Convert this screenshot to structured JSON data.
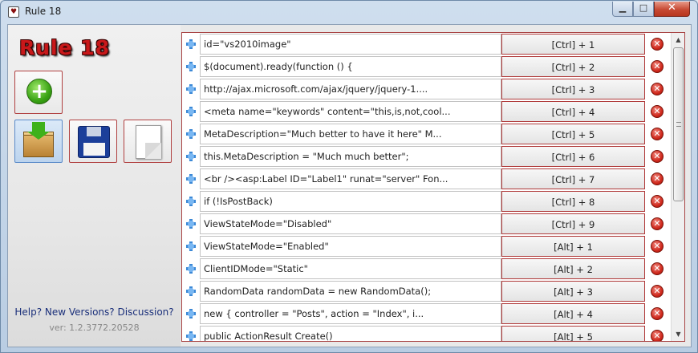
{
  "window": {
    "title": "Rule 18",
    "app_icon": "heart-icon"
  },
  "left_panel": {
    "logo_text": "Rule 18",
    "help_link": "Help? New Versions? Discussion?",
    "version": "ver: 1.2.3772.20528",
    "tools": [
      {
        "name": "add-rule-button",
        "icon": "plus-icon"
      },
      {
        "name": "load-button",
        "icon": "box-download-icon"
      },
      {
        "name": "save-button",
        "icon": "floppy-icon"
      },
      {
        "name": "new-button",
        "icon": "blank-page-icon"
      }
    ]
  },
  "rules": [
    {
      "text": "id=\"vs2010image\"",
      "hotkey": "[Ctrl] + 1"
    },
    {
      "text": "$(document).ready(function () {",
      "hotkey": "[Ctrl] + 2"
    },
    {
      "text": "http://ajax.microsoft.com/ajax/jquery/jquery-1....",
      "hotkey": "[Ctrl] + 3"
    },
    {
      "text": "<meta name=\"keywords\" content=\"this,is,not,cool...",
      "hotkey": "[Ctrl] + 4"
    },
    {
      "text": "MetaDescription=\"Much better to have it here\" M...",
      "hotkey": "[Ctrl] + 5"
    },
    {
      "text": "this.MetaDescription = \"Much much better\";",
      "hotkey": "[Ctrl] + 6"
    },
    {
      "text": "<br /><asp:Label ID=\"Label1\" runat=\"server\" Fon...",
      "hotkey": "[Ctrl] + 7"
    },
    {
      "text": "if (!IsPostBack)",
      "hotkey": "[Ctrl] + 8"
    },
    {
      "text": "ViewStateMode=\"Disabled\"",
      "hotkey": "[Ctrl] + 9"
    },
    {
      "text": "ViewStateMode=\"Enabled\"",
      "hotkey": "[Alt] + 1"
    },
    {
      "text": "ClientIDMode=\"Static\"",
      "hotkey": "[Alt] + 2"
    },
    {
      "text": "RandomData randomData = new RandomData();",
      "hotkey": "[Alt] + 3"
    },
    {
      "text": "new { controller = \"Posts\", action = \"Index\", i...",
      "hotkey": "[Alt] + 4"
    },
    {
      "text": "public ActionResult Create()",
      "hotkey": "[Alt] + 5"
    }
  ],
  "colors": {
    "accent_red": "#b03a3a",
    "drag_blue": "#3b88d6"
  }
}
